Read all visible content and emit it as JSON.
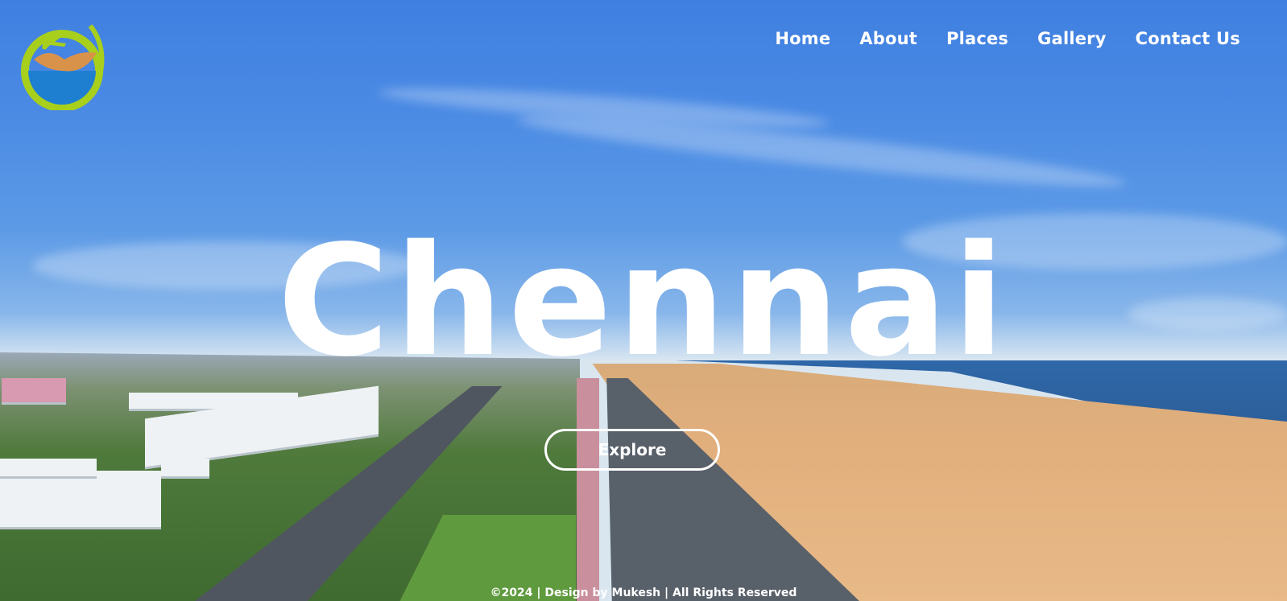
{
  "nav": {
    "items": [
      {
        "label": "Home"
      },
      {
        "label": "About"
      },
      {
        "label": "Places"
      },
      {
        "label": "Gallery"
      },
      {
        "label": "Contact Us"
      }
    ]
  },
  "hero": {
    "title": "Chennai",
    "button_label": "Explore"
  },
  "footer": {
    "text": "©2024 | Design by Mukesh | All Rights Reserved"
  },
  "colors": {
    "sky": "#4a8ae4",
    "sea": "#2f67a8",
    "sand": "#e2b07d",
    "text": "#ffffff",
    "logo_green": "#a8cf1c",
    "logo_blue": "#1e7fd1",
    "logo_orange": "#d9924a"
  },
  "icons": {
    "logo": "travel-logo-plane-icon"
  }
}
